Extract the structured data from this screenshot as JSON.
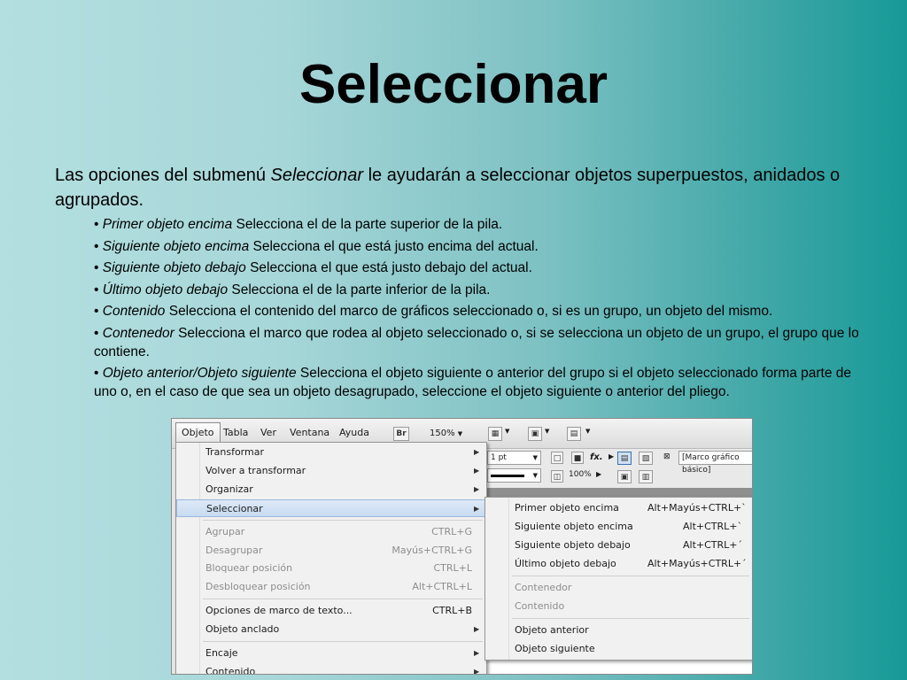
{
  "slide": {
    "title": "Seleccionar",
    "intro_pre": "Las opciones del submenú ",
    "intro_term": "Seleccionar",
    "intro_post": " le ayudarán a seleccionar objetos superpuestos, anidados o agrupados.",
    "bullets": [
      {
        "term": "Primer objeto encima",
        "text": " Selecciona el de la parte superior de la pila."
      },
      {
        "term": "Siguiente objeto encima",
        "text": " Selecciona el que está justo encima del actual."
      },
      {
        "term": "Siguiente objeto debajo",
        "text": " Selecciona el que está justo debajo del actual."
      },
      {
        "term": "Último objeto debajo",
        "text": " Selecciona el de la parte inferior de la pila."
      },
      {
        "term": "Contenido",
        "text": " Selecciona el contenido del marco de gráficos seleccionado o, si es un grupo, un objeto del  mismo."
      },
      {
        "term": "Contenedor",
        "text": " Selecciona el marco que rodea al objeto seleccionado o, si se selecciona un objeto de un grupo, el grupo que lo contiene."
      },
      {
        "term": "Objeto anterior/Objeto siguiente",
        "text": " Selecciona el objeto siguiente o anterior del grupo si el objeto seleccionado forma parte de uno o, en el caso de que sea un objeto desagrupado, seleccione el objeto siguiente o anterior del pliego."
      }
    ],
    "bullet_char": "•"
  },
  "app": {
    "menubar": [
      "Objeto",
      "Tabla",
      "Ver",
      "Ventana",
      "Ayuda"
    ],
    "br_label": "Br",
    "zoom": "150%",
    "stroke_weight": "1 pt",
    "opacity": "100%",
    "style_field": "[Marco gráfico básico]",
    "fx_label": "fx."
  },
  "objeto_menu": {
    "items": [
      {
        "label": "Transformar",
        "shortcut": "",
        "submenu": true,
        "disabled": false
      },
      {
        "label": "Volver a transformar",
        "shortcut": "",
        "submenu": true,
        "disabled": false
      },
      {
        "label": "Organizar",
        "shortcut": "",
        "submenu": true,
        "disabled": false
      },
      {
        "label": "Seleccionar",
        "shortcut": "",
        "submenu": true,
        "disabled": false,
        "highlighted": true
      },
      {
        "label": "Agrupar",
        "shortcut": "CTRL+G",
        "submenu": false,
        "disabled": true
      },
      {
        "label": "Desagrupar",
        "shortcut": "Mayús+CTRL+G",
        "submenu": false,
        "disabled": true
      },
      {
        "label": "Bloquear posición",
        "shortcut": "CTRL+L",
        "submenu": false,
        "disabled": true
      },
      {
        "label": "Desbloquear posición",
        "shortcut": "Alt+CTRL+L",
        "submenu": false,
        "disabled": true
      },
      {
        "label": "Opciones de marco de texto...",
        "shortcut": "CTRL+B",
        "submenu": false,
        "disabled": false
      },
      {
        "label": "Objeto anclado",
        "shortcut": "",
        "submenu": true,
        "disabled": false
      },
      {
        "label": "Encaje",
        "shortcut": "",
        "submenu": true,
        "disabled": false
      },
      {
        "label": "Contenido",
        "shortcut": "",
        "submenu": true,
        "disabled": false
      }
    ]
  },
  "seleccionar_menu": {
    "items": [
      {
        "label": "Primer objeto encima",
        "shortcut": "Alt+Mayús+CTRL+`",
        "disabled": false
      },
      {
        "label": "Siguiente objeto encima",
        "shortcut": "Alt+CTRL+`",
        "disabled": false
      },
      {
        "label": "Siguiente objeto debajo",
        "shortcut": "Alt+CTRL+´",
        "disabled": false
      },
      {
        "label": "Último objeto debajo",
        "shortcut": "Alt+Mayús+CTRL+´",
        "disabled": false
      },
      {
        "label": "Contenedor",
        "shortcut": "",
        "disabled": true
      },
      {
        "label": "Contenido",
        "shortcut": "",
        "disabled": true
      },
      {
        "label": "Objeto anterior",
        "shortcut": "",
        "disabled": false
      },
      {
        "label": "Objeto siguiente",
        "shortcut": "",
        "disabled": false
      }
    ]
  }
}
